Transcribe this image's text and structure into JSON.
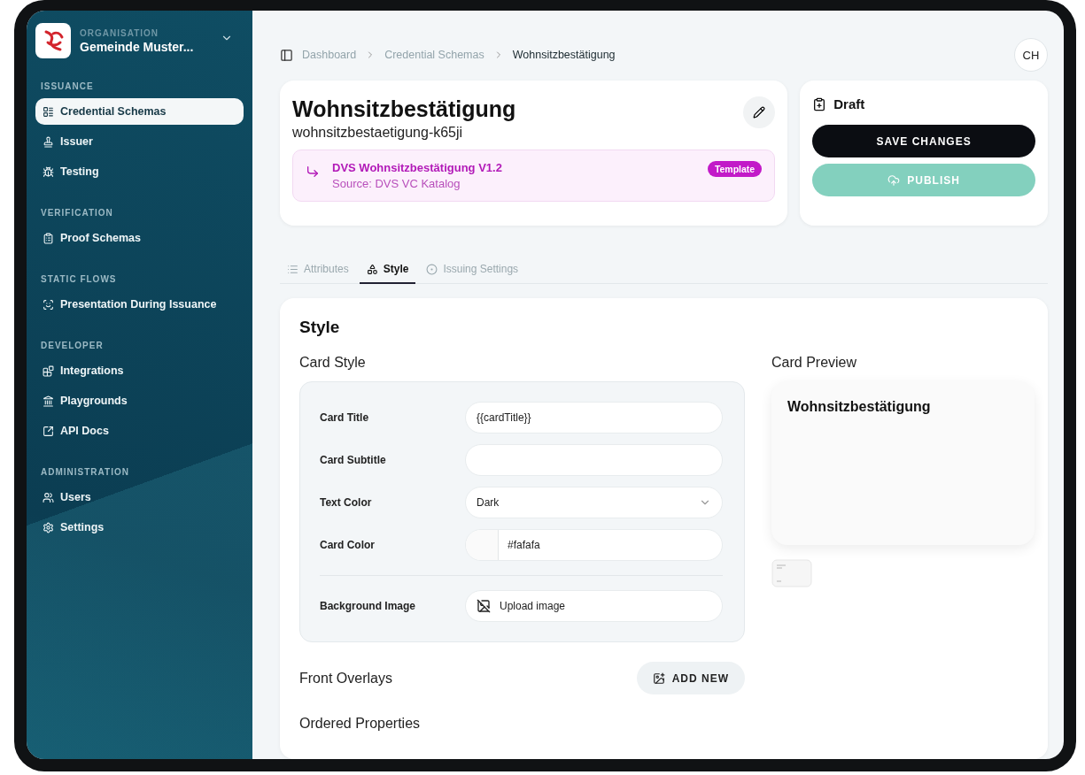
{
  "organisation": {
    "caption": "ORGANISATION",
    "name": "Gemeinde Muster..."
  },
  "sidebar": {
    "sections": [
      {
        "title": "ISSUANCE",
        "items": [
          {
            "label": "Credential Schemas",
            "selected": true
          },
          {
            "label": "Issuer",
            "selected": false
          },
          {
            "label": "Testing",
            "selected": false
          }
        ]
      },
      {
        "title": "VERIFICATION",
        "items": [
          {
            "label": "Proof Schemas",
            "selected": false
          }
        ]
      },
      {
        "title": "STATIC FLOWS",
        "items": [
          {
            "label": "Presentation During Issuance",
            "selected": false
          }
        ]
      },
      {
        "title": "DEVELOPER",
        "items": [
          {
            "label": "Integrations",
            "selected": false
          },
          {
            "label": "Playgrounds",
            "selected": false
          },
          {
            "label": "API Docs",
            "selected": false
          }
        ]
      },
      {
        "title": "ADMINISTRATION",
        "items": [
          {
            "label": "Users",
            "selected": false
          },
          {
            "label": "Settings",
            "selected": false
          }
        ]
      }
    ]
  },
  "breadcrumb": [
    "Dashboard",
    "Credential Schemas",
    "Wohnsitzbestätigung"
  ],
  "avatar": "CH",
  "schema": {
    "title": "Wohnsitzbestätigung",
    "slug": "wohnsitzbestaetigung-k65ji",
    "template": {
      "name": "DVS Wohnsitzbestätigung V1.2",
      "source": "Source: DVS VC Katalog",
      "badge": "Template"
    }
  },
  "status": {
    "label": "Draft",
    "buttons": [
      {
        "label": "SAVE CHANGES",
        "kind": "primary",
        "disabled": false
      },
      {
        "label": "PUBLISH",
        "kind": "publish",
        "disabled": true
      }
    ]
  },
  "tabs": [
    {
      "label": "Attributes",
      "selected": false
    },
    {
      "label": "Style",
      "selected": true
    },
    {
      "label": "Issuing Settings",
      "selected": false
    }
  ],
  "style": {
    "heading": "Style",
    "card_style_title": "Card Style",
    "fields": [
      {
        "kind": "text",
        "label": "Card Title",
        "value": "{{cardTitle}}"
      },
      {
        "kind": "text",
        "label": "Card Subtitle"
      },
      {
        "kind": "select",
        "label": "Text Color",
        "value": "Dark"
      },
      {
        "kind": "color",
        "label": "Card Color",
        "value": "#fafafa"
      },
      {
        "kind": "upload",
        "label": "Background Image",
        "value": "Upload image"
      }
    ],
    "preview_title": "Card Preview",
    "preview_card_title": "Wohnsitzbestätigung",
    "front_overlays": "Front Overlays",
    "add_new": "ADD NEW",
    "ordered_properties": "Ordered Properties"
  }
}
